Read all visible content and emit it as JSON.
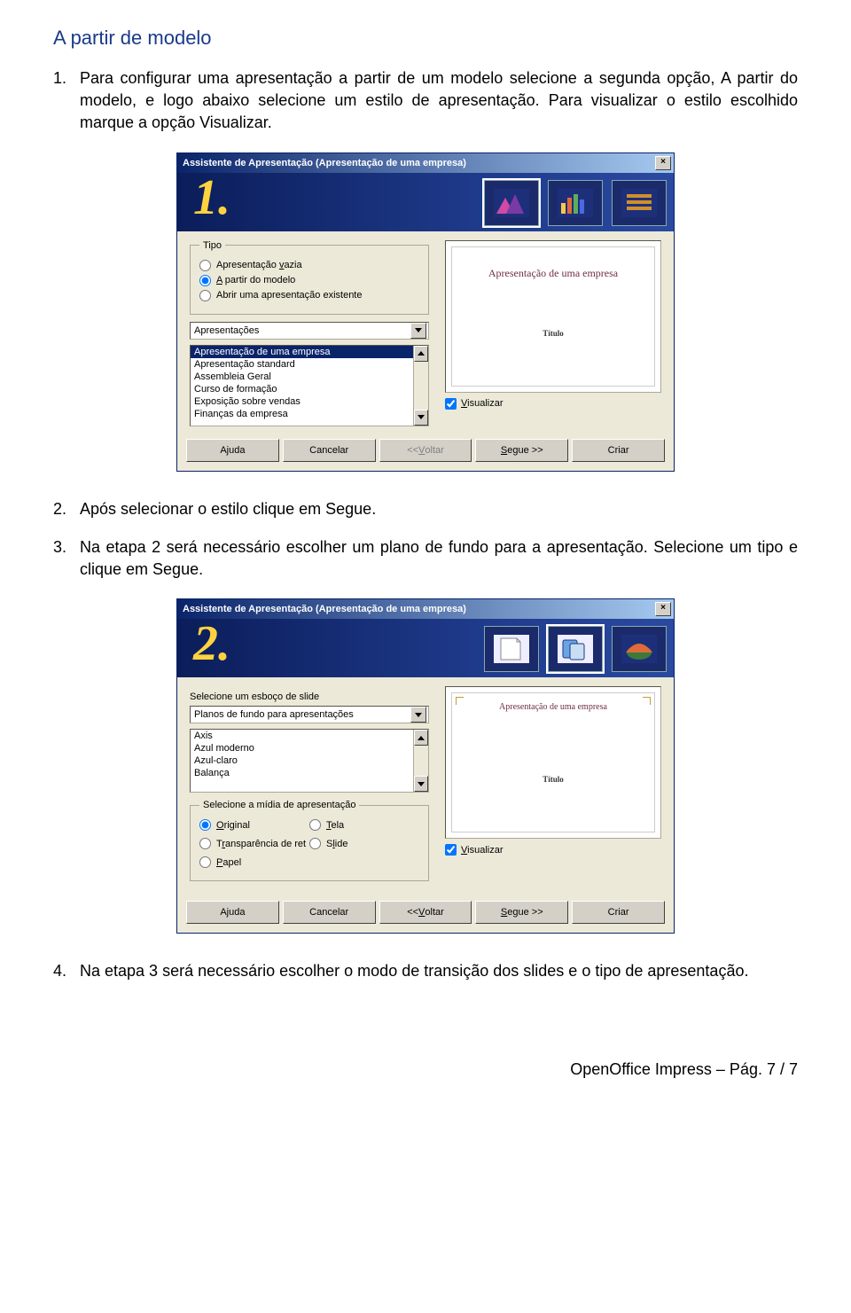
{
  "doc": {
    "section_title": "A partir de modelo",
    "steps": {
      "s1": {
        "num": "1.",
        "text": "Para configurar uma apresentação a partir de um modelo selecione a segunda opção, A partir do modelo, e logo abaixo selecione um estilo de apresentação. Para visualizar o estilo escolhido marque a opção Visualizar."
      },
      "s2": {
        "num": "2.",
        "text": "Após selecionar o estilo clique em Segue."
      },
      "s3": {
        "num": "3.",
        "text": "Na etapa 2 será necessário escolher um plano de fundo para a apresentação. Selecione um tipo e clique em Segue."
      },
      "s4": {
        "num": "4.",
        "text": "Na etapa 3 será necessário escolher o modo de transição dos slides e o tipo de apresentação."
      }
    }
  },
  "dialog1": {
    "title": "Assistente de Apresentação (Apresentação de uma empresa)",
    "step_number": "1.",
    "group_type": "Tipo",
    "radios": {
      "r1_full": "Apresentação vazia",
      "r1_accel": "v",
      "r2_full": "A partir do modelo",
      "r2_accel": "A",
      "r3_full": "Abrir uma apresentação existente"
    },
    "selected_radio": 1,
    "select_category": "Apresentações",
    "list_items": [
      "Apresentação de uma empresa",
      "Apresentação standard",
      "Assembleia Geral",
      "Curso de formação",
      "Exposição sobre vendas",
      "Finanças da empresa"
    ],
    "list_selected": 0,
    "preview_title": "Apresentação de uma empresa",
    "preview_sub": "Título",
    "check_visualizar": "Visualizar",
    "check_visualizar_accel": "V",
    "buttons": {
      "help": "Ajuda",
      "help_accel": "j",
      "cancel": "Cancelar",
      "back": "<< Voltar",
      "back_accel": "V",
      "next": "Segue >>",
      "next_accel": "S",
      "create": "Criar"
    }
  },
  "dialog2": {
    "title": "Assistente de Apresentação (Apresentação de uma empresa)",
    "step_number": "2.",
    "group_esboco": "Selecione um esboço de slide",
    "select_category": "Planos de fundo para apresentações",
    "list_items": [
      "Axis",
      "Azul moderno",
      "Azul-claro",
      "Balança"
    ],
    "list_selected": -1,
    "group_midia": "Selecione a mídia de apresentação",
    "media": {
      "m1": "Original",
      "m1_accel": "O",
      "m2": "Tela",
      "m2_accel": "T",
      "m3": "Transparência de ret",
      "m3_accel": "r",
      "m4": "Slide",
      "m4_accel": "l",
      "m5": "Papel",
      "m5_accel": "P"
    },
    "media_selected": 0,
    "preview_title": "Apresentação de uma empresa",
    "preview_sub": "Título",
    "check_visualizar": "Visualizar",
    "check_visualizar_accel": "V",
    "buttons": {
      "help": "Ajuda",
      "help_accel": "j",
      "cancel": "Cancelar",
      "back": "<< Voltar",
      "back_accel": "V",
      "next": "Segue >>",
      "next_accel": "S",
      "create": "Criar"
    }
  },
  "footer": "OpenOffice Impress – Pág. 7 / 7"
}
